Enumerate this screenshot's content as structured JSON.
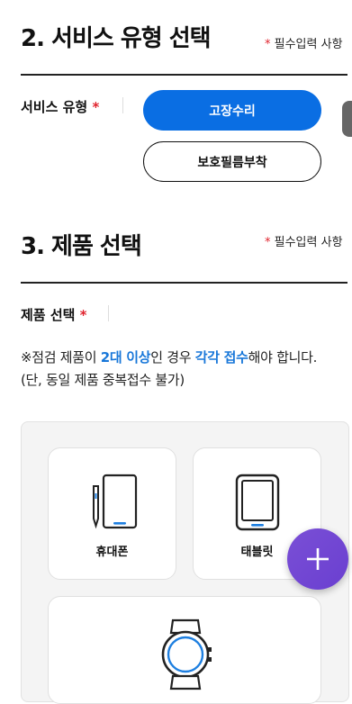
{
  "section2": {
    "title": "2. 서비스 유형 선택",
    "required_note": "필수입력 사항",
    "star": "*"
  },
  "service_type": {
    "label": "서비스 유형",
    "star": "*",
    "options": [
      "고장수리",
      "보호필름부착"
    ],
    "selected": "고장수리"
  },
  "section3": {
    "title": "3. 제품 선택",
    "required_note": "필수입력 사항",
    "star": "*"
  },
  "product_select": {
    "label": "제품 선택",
    "star": "*"
  },
  "notice": {
    "prefix": "※점검 제품이 ",
    "hl1": "2대 이상",
    "mid": "인 경우 ",
    "hl2": "각각 접수",
    "suffix": "해야 합니다.",
    "line2": "(단, 동일 제품 중복접수 불가)"
  },
  "products": [
    {
      "label": "휴대폰",
      "icon": "phone-icon"
    },
    {
      "label": "태블릿",
      "icon": "tablet-icon"
    },
    {
      "label": "",
      "icon": "watch-icon"
    }
  ],
  "fab": {
    "icon": "plus-icon"
  },
  "colors": {
    "primary": "#0a6ee3",
    "required": "#e0242e",
    "highlight": "#1877d9",
    "fab": "#7a4fd6"
  }
}
